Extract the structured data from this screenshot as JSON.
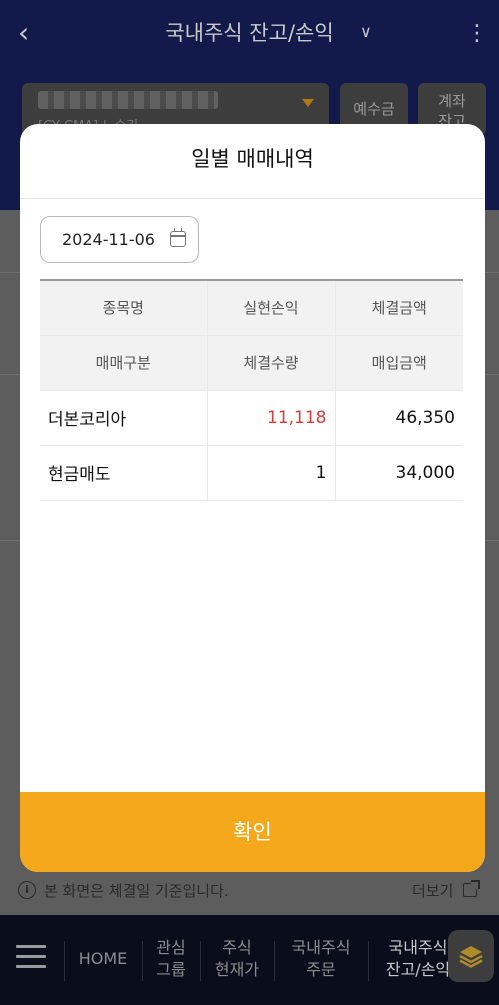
{
  "header": {
    "title": "국내주식 잔고/손익",
    "account_sub": "[CY CMA] 노승기",
    "deposit_label": "예수금",
    "account_balance_label_line1": "계좌",
    "account_balance_label_line2": "잔고"
  },
  "modal": {
    "title": "일별 매매내역",
    "date": "2024-11-06",
    "columns_row1": [
      "종목명",
      "실현손익",
      "체결금액"
    ],
    "columns_row2": [
      "매매구분",
      "체결수량",
      "매입금액"
    ],
    "rows": [
      {
        "name": "더본코리아",
        "realized_pl": "11,118",
        "exec_amount": "46,350"
      },
      {
        "trade_type": "현금매도",
        "exec_qty": "1",
        "purchase_amount": "34,000"
      }
    ],
    "confirm_label": "확인"
  },
  "footer": {
    "note": "본 화면은 체결일 기준입니다.",
    "more_label": "더보기"
  },
  "bottom_nav": {
    "items": [
      {
        "line1": "HOME",
        "line2": ""
      },
      {
        "line1": "관심",
        "line2": "그룹"
      },
      {
        "line1": "주식",
        "line2": "현재가"
      },
      {
        "line1": "국내주식",
        "line2": "주문"
      },
      {
        "line1": "국내주식",
        "line2": "잔고/손익"
      }
    ]
  },
  "colors": {
    "accent": "#f5a81c",
    "profit": "#d73c3c",
    "header_bg": "#111a4a"
  }
}
